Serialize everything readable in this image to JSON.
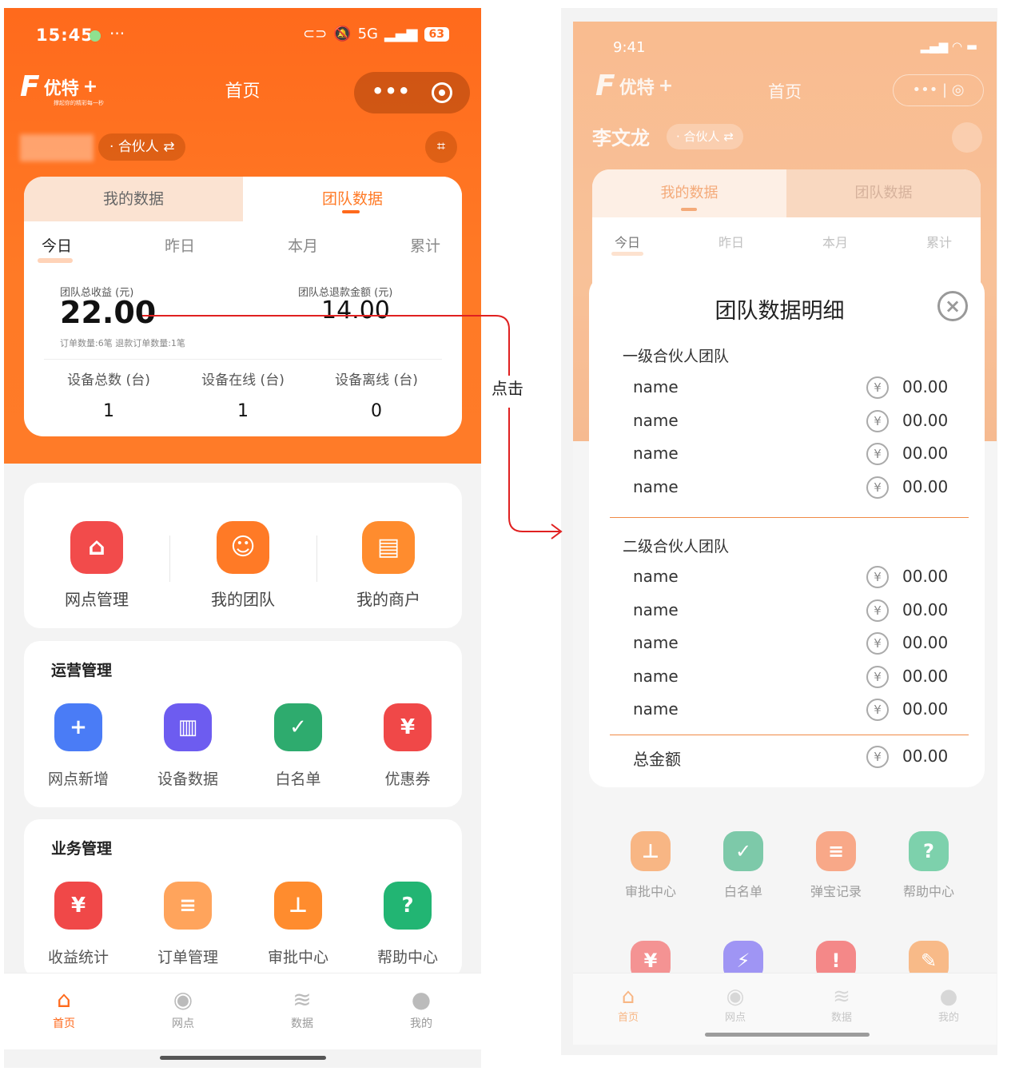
{
  "annotation": {
    "click_label": "点击"
  },
  "left": {
    "status": {
      "time": "15:45",
      "more": "···",
      "network": "5G",
      "battery": "63"
    },
    "nav": {
      "logo_text": "优特",
      "logo_plus": "+",
      "logo_sub": "撑起你的精彩每一秒",
      "title": "首页",
      "capsule_dots": "•••"
    },
    "user": {
      "role": "合伙人",
      "role_swap": "⇄"
    },
    "card": {
      "tabs": [
        "我的数据",
        "团队数据"
      ],
      "periods": [
        "今日",
        "昨日",
        "本月",
        "累计"
      ],
      "income_label": "团队总收益 (元)",
      "income_value": "22.00",
      "refund_label": "团队总退款金额 (元)",
      "refund_value": "14.00",
      "order_note": "订单数量:6笔 退款订单数量:1笔",
      "devices": [
        {
          "label": "设备总数 (台)",
          "value": "1"
        },
        {
          "label": "设备在线 (台)",
          "value": "1"
        },
        {
          "label": "设备离线 (台)",
          "value": "0"
        }
      ]
    },
    "quick": [
      {
        "label": "网点管理",
        "color": "#f24b4b",
        "glyph": "⌂"
      },
      {
        "label": "我的团队",
        "color": "#ff7a26",
        "glyph": "☺"
      },
      {
        "label": "我的商户",
        "color": "#ff8c2e",
        "glyph": "▤"
      }
    ],
    "ops": {
      "title": "运营管理",
      "items": [
        {
          "label": "网点新增",
          "color": "#4a7cf6",
          "glyph": "+"
        },
        {
          "label": "设备数据",
          "color": "#6d5cf0",
          "glyph": "▥"
        },
        {
          "label": "白名单",
          "color": "#2eab6e",
          "glyph": "✓"
        },
        {
          "label": "优惠券",
          "color": "#f04848",
          "glyph": "¥"
        }
      ]
    },
    "biz": {
      "title": "业务管理",
      "items": [
        {
          "label": "收益统计",
          "color": "#f04848",
          "glyph": "¥"
        },
        {
          "label": "订单管理",
          "color": "#ffa45c",
          "glyph": "≡"
        },
        {
          "label": "审批中心",
          "color": "#ff8c2e",
          "glyph": "⊥"
        },
        {
          "label": "帮助中心",
          "color": "#22b573",
          "glyph": "?"
        }
      ]
    },
    "tabbar": [
      {
        "label": "首页",
        "glyph": "⌂"
      },
      {
        "label": "网点",
        "glyph": "◉"
      },
      {
        "label": "数据",
        "glyph": "≋"
      },
      {
        "label": "我的",
        "glyph": "●"
      }
    ]
  },
  "right": {
    "status": {
      "time": "9:41"
    },
    "nav": {
      "logo_text": "优特",
      "logo_plus": "+",
      "title": "首页",
      "capsule": "••• | ◎"
    },
    "user": {
      "name": "李文龙",
      "role": "合伙人",
      "role_swap": "⇄"
    },
    "card": {
      "tabs": [
        "我的数据",
        "团队数据"
      ],
      "periods": [
        "今日",
        "昨日",
        "本月",
        "累计"
      ]
    },
    "grid": [
      {
        "label": "审批中心",
        "color": "#f59a55",
        "glyph": "⊥"
      },
      {
        "label": "白名单",
        "color": "#4bb488",
        "glyph": "✓"
      },
      {
        "label": "弹宝记录",
        "color": "#f5875a",
        "glyph": "≡"
      },
      {
        "label": "帮助中心",
        "color": "#4bc08c",
        "glyph": "?"
      }
    ],
    "tabbar": [
      {
        "label": "首页",
        "glyph": "⌂"
      },
      {
        "label": "网点",
        "glyph": "◉"
      },
      {
        "label": "数据",
        "glyph": "≋"
      },
      {
        "label": "我的",
        "glyph": "●"
      }
    ],
    "modal": {
      "title": "团队数据明细",
      "close": "×",
      "currency": "¥",
      "group1_title": "一级合伙人团队",
      "group1": [
        {
          "name": "name",
          "value": "00.00"
        },
        {
          "name": "name",
          "value": "00.00"
        },
        {
          "name": "name",
          "value": "00.00"
        },
        {
          "name": "name",
          "value": "00.00"
        }
      ],
      "group2_title": "二级合伙人团队",
      "group2": [
        {
          "name": "name",
          "value": "00.00"
        },
        {
          "name": "name",
          "value": "00.00"
        },
        {
          "name": "name",
          "value": "00.00"
        },
        {
          "name": "name",
          "value": "00.00"
        },
        {
          "name": "name",
          "value": "00.00"
        }
      ],
      "total_label": "总金额",
      "total_value": "00.00"
    }
  }
}
